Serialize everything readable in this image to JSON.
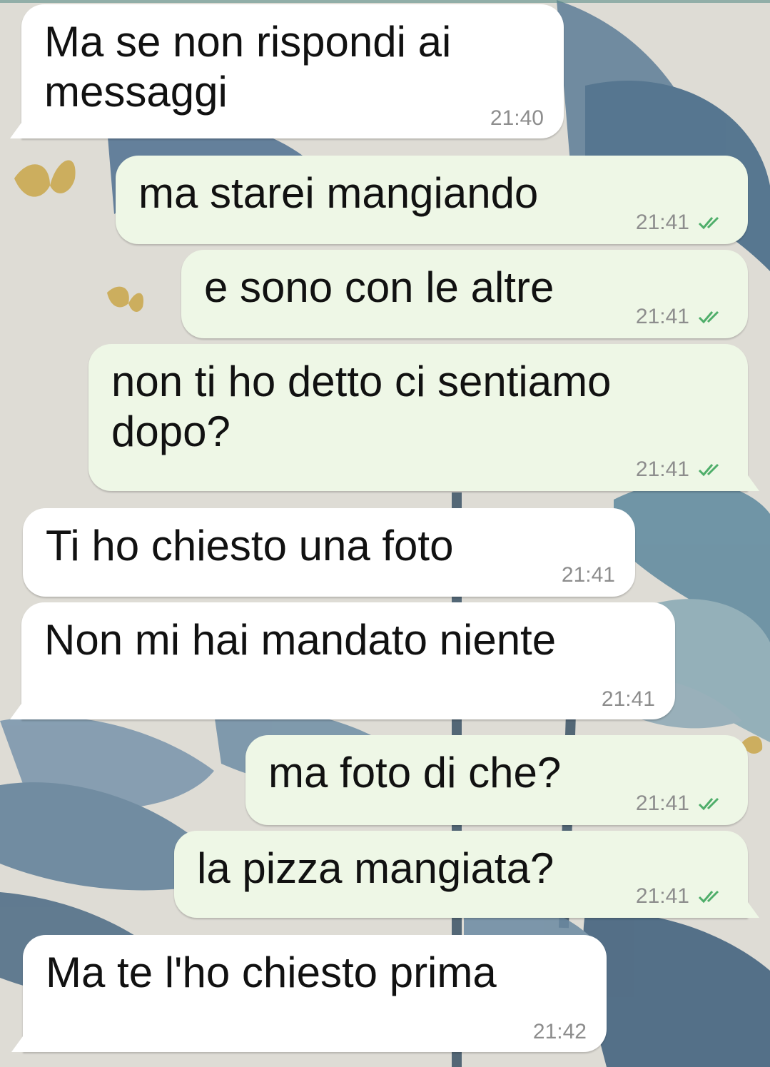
{
  "chat": {
    "messages": [
      {
        "direction": "incoming",
        "text": "Ma se non rispondi ai\nmessaggi",
        "time": "21:40"
      },
      {
        "direction": "outgoing",
        "text": "ma starei mangiando",
        "time": "21:41",
        "status": "read"
      },
      {
        "direction": "outgoing",
        "text": "e sono con le altre",
        "time": "21:41",
        "status": "read"
      },
      {
        "direction": "outgoing",
        "text": "non ti ho detto ci sentiamo\ndopo?",
        "time": "21:41",
        "status": "read"
      },
      {
        "direction": "incoming",
        "text": "Ti ho chiesto una foto",
        "time": "21:41"
      },
      {
        "direction": "incoming",
        "text": "Non mi hai mandato niente",
        "time": "21:41"
      },
      {
        "direction": "outgoing",
        "text": "ma foto di che?",
        "time": "21:41",
        "status": "read"
      },
      {
        "direction": "outgoing",
        "text": "la pizza mangiata?",
        "time": "21:41",
        "status": "read"
      },
      {
        "direction": "incoming",
        "text": "Ma te l'ho chiesto prima",
        "time": "21:42"
      }
    ]
  },
  "colors": {
    "incoming_bubble": "#ffffff",
    "outgoing_bubble": "#eef7e6",
    "read_check": "#4fae6a",
    "timestamp": "#8d8d8d"
  },
  "icons": {
    "read_receipt": "double-check-icon"
  }
}
